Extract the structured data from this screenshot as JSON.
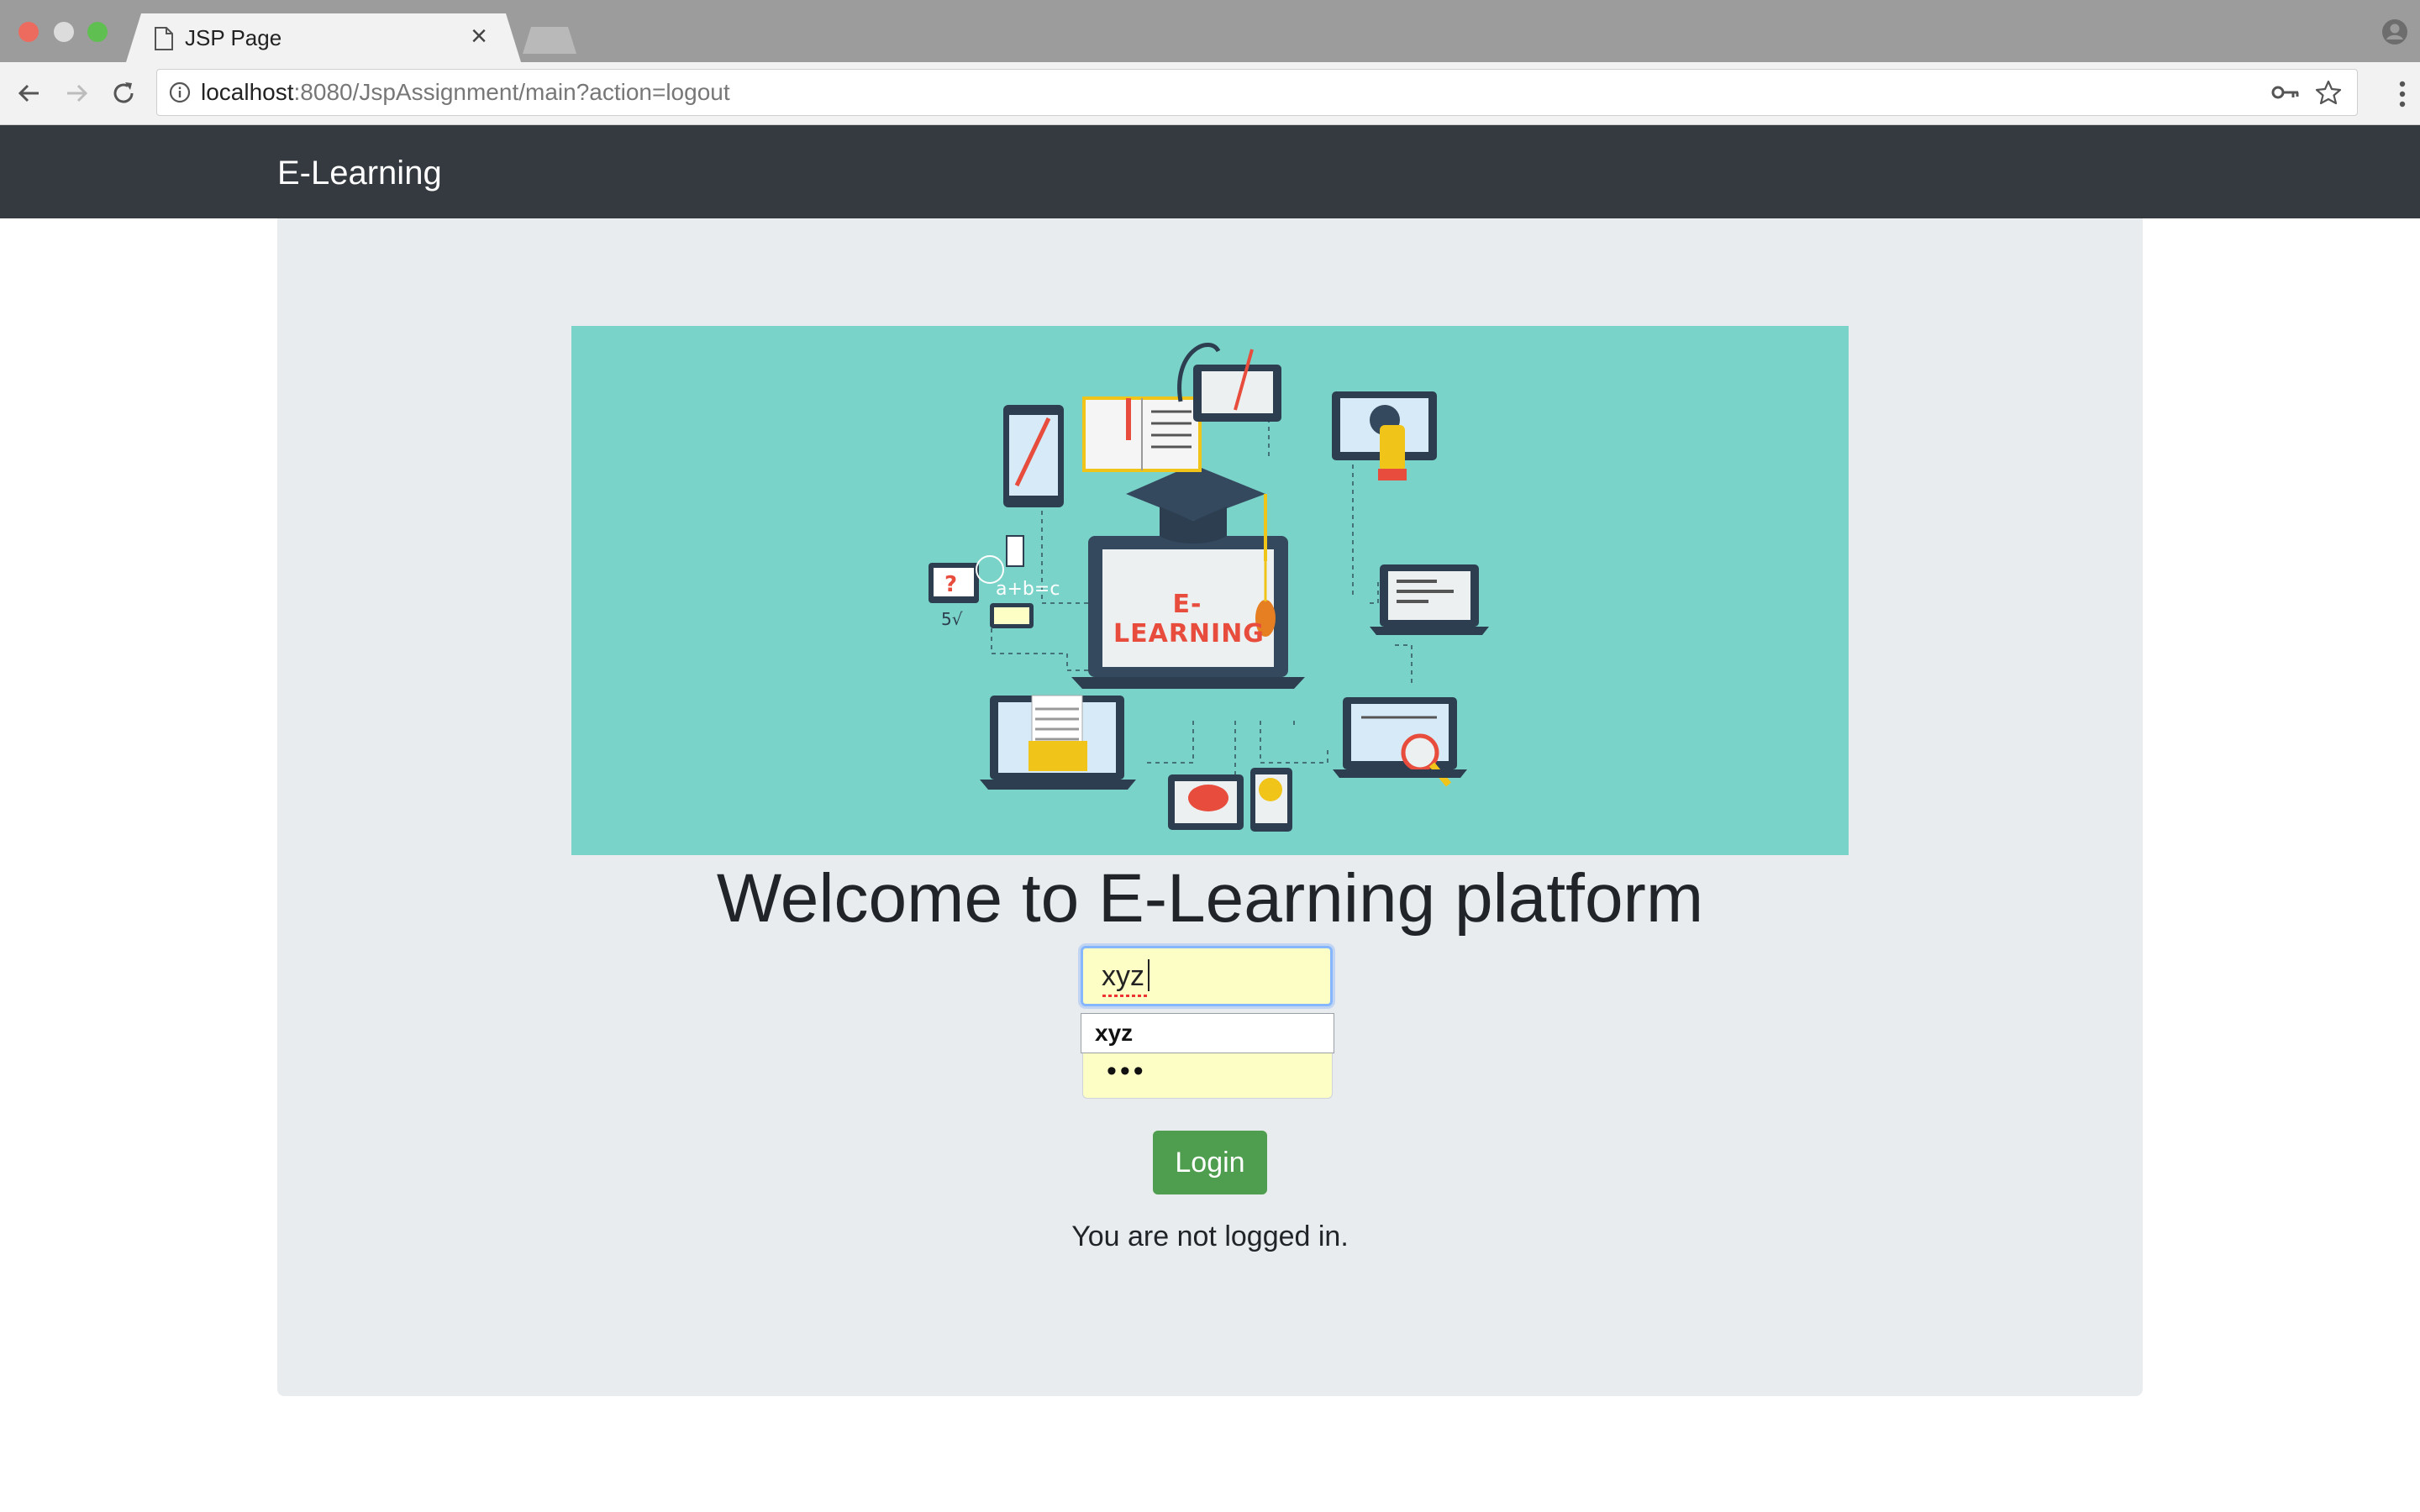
{
  "browser": {
    "tab_title": "JSP Page",
    "tab_close": "×",
    "url_host": "localhost",
    "url_rest": ":8080/JspAssignment/main?action=logout",
    "icons": [
      "page-icon",
      "close-icon",
      "back-icon",
      "forward-icon",
      "reload-icon",
      "info-icon",
      "key-icon",
      "star-icon",
      "menu-icon",
      "profile-icon"
    ]
  },
  "navbar": {
    "brand": "E-Learning",
    "background": "#343a40"
  },
  "main": {
    "banner_text": "E-LEARNING",
    "banner_color": "#7ad3c9",
    "heading": "Welcome to E-Learning platform",
    "username_value": "xyz",
    "autocomplete_suggestion": "xyz",
    "password_mask": "•••",
    "login_label": "Login",
    "login_color": "#4f9d4f",
    "status": "You are not logged in."
  }
}
